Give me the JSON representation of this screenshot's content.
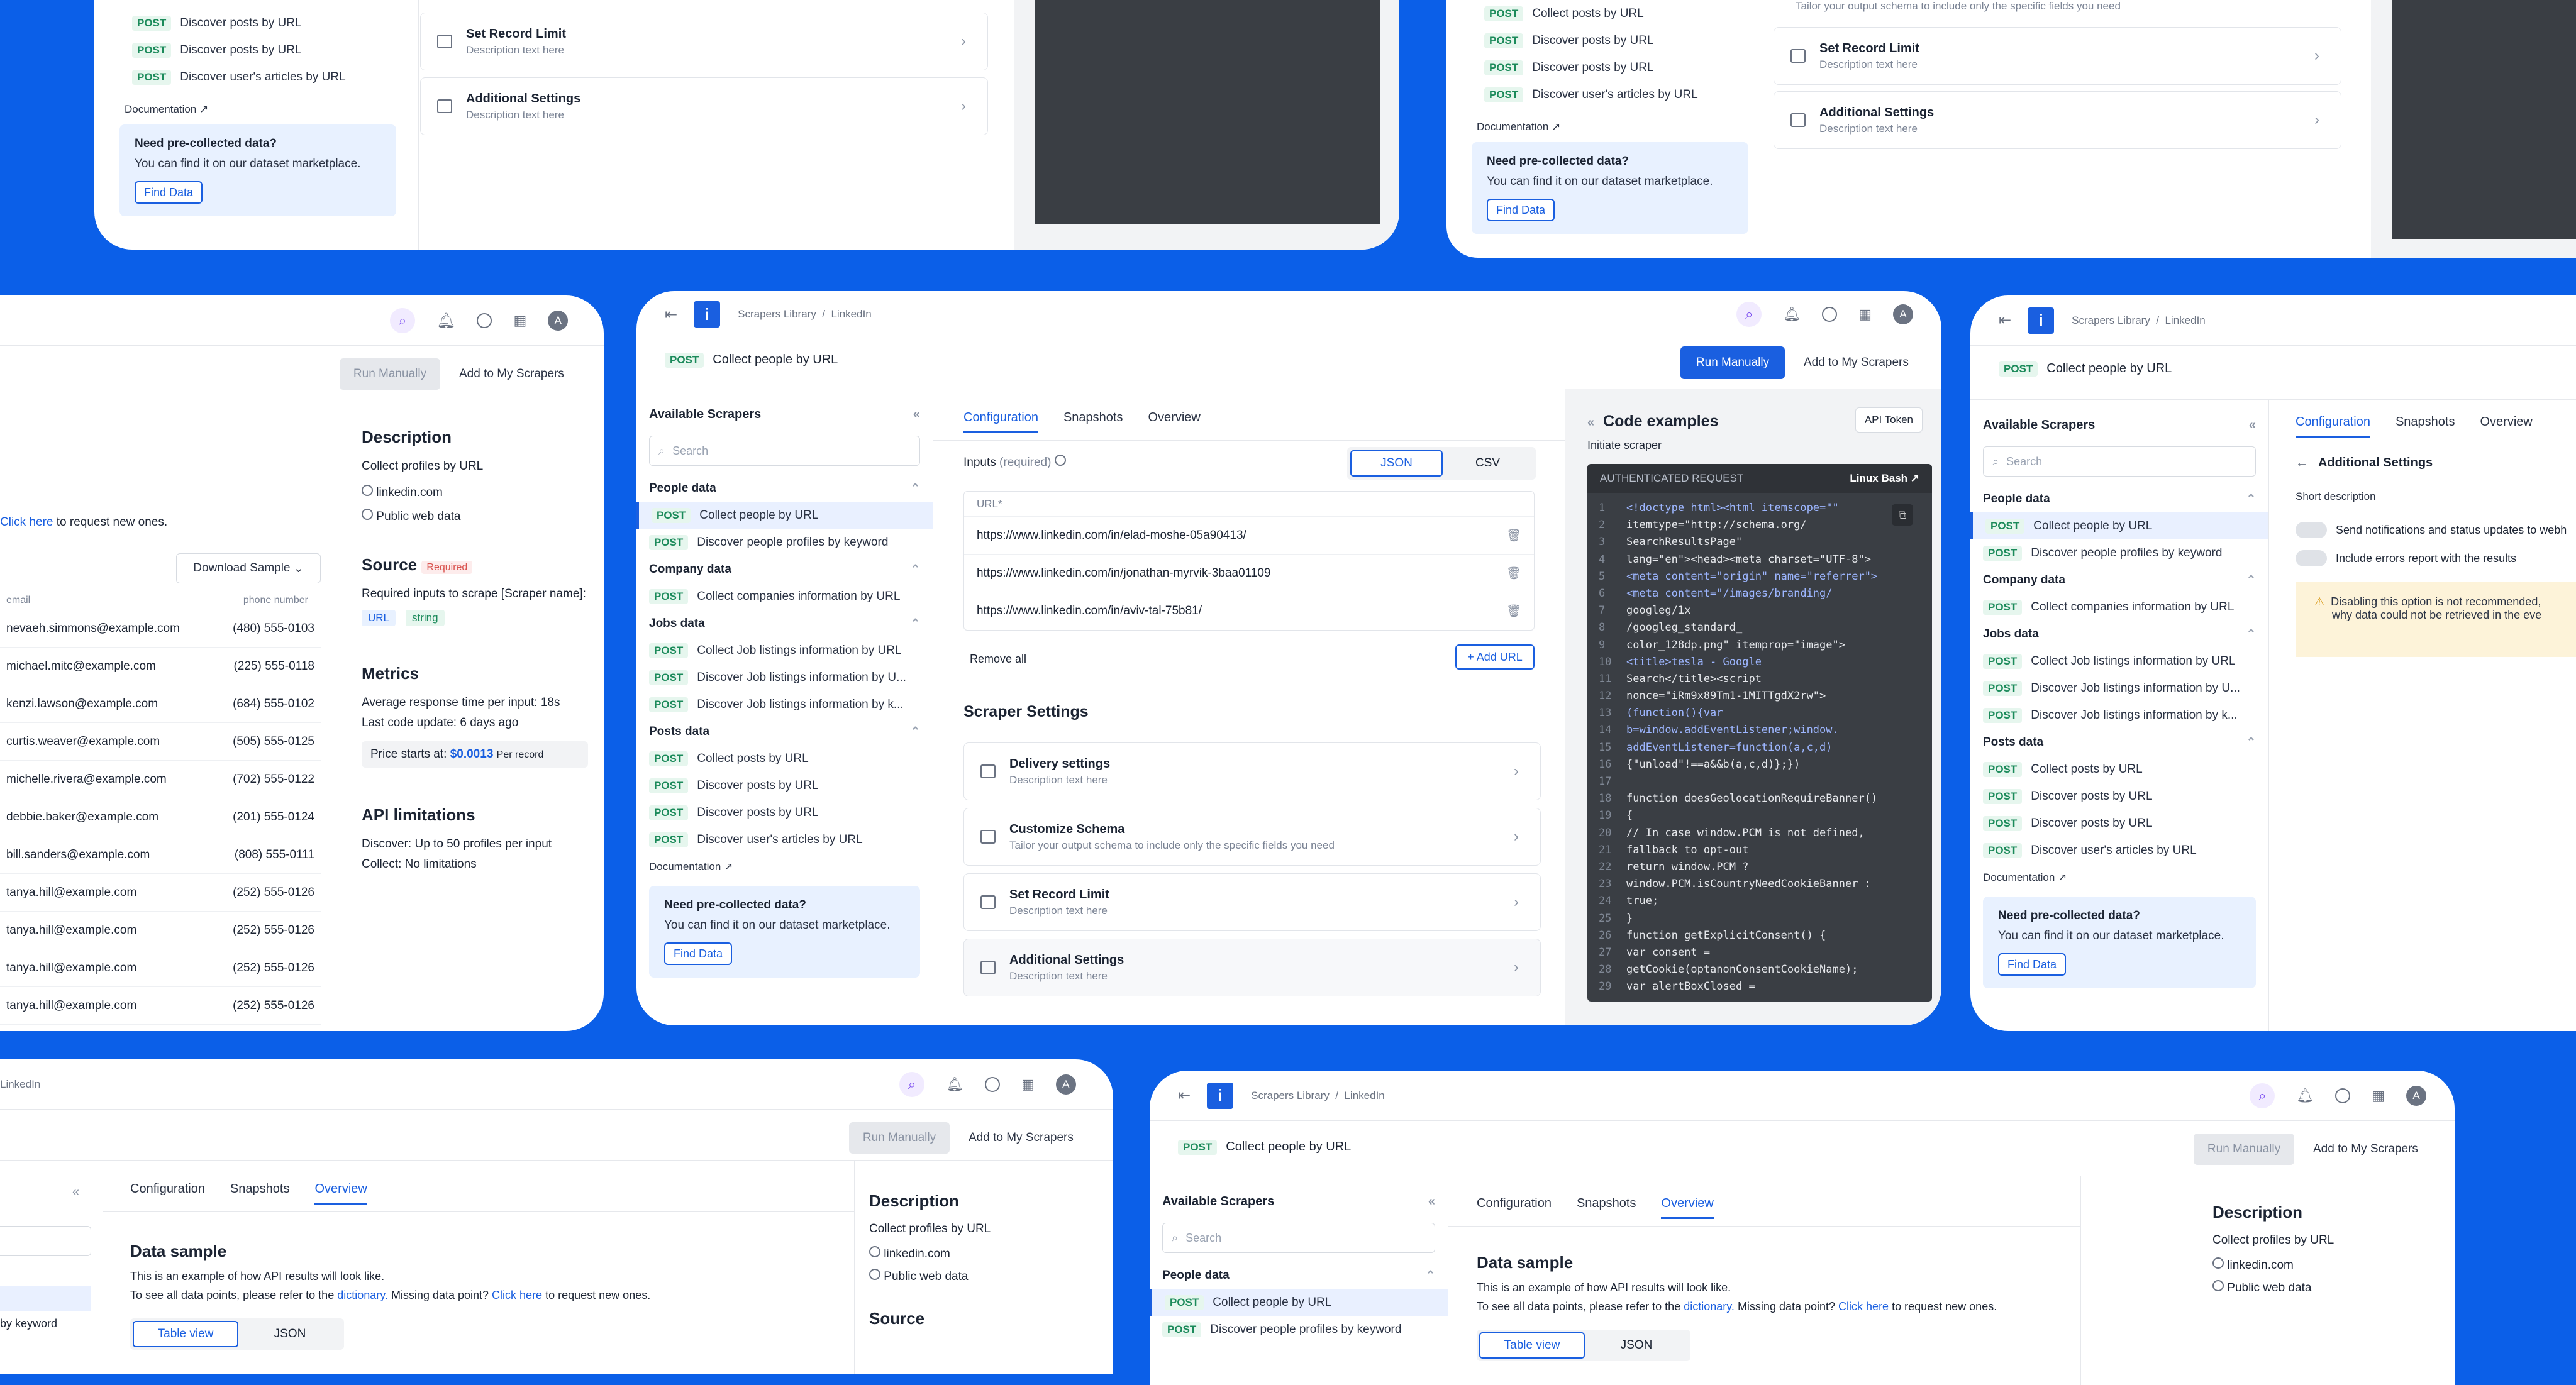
{
  "breadcrumb": {
    "root": "Scrapers Library",
    "sep": "/",
    "current": "LinkedIn"
  },
  "page": {
    "method": "POST",
    "title": "Collect people by URL"
  },
  "actions": {
    "run": "Run Manually",
    "add": "Add to My Scrapers"
  },
  "avatar": "A",
  "sidebar": {
    "title": "Available Scrapers",
    "search_placeholder": "Search",
    "groups": [
      {
        "name": "People data",
        "items": [
          "Collect people by URL",
          "Discover people profiles by keyword"
        ]
      },
      {
        "name": "Company data",
        "items": [
          "Collect companies information by URL"
        ]
      },
      {
        "name": "Jobs data",
        "items": [
          "Collect Job listings information by URL",
          "Discover Job listings information by U...",
          "Discover Job listings information by k..."
        ]
      },
      {
        "name": "Posts data",
        "items": [
          "Collect posts by URL",
          "Discover posts by URL",
          "Discover posts by URL",
          "Discover user's articles by URL"
        ]
      }
    ],
    "documentation": "Documentation",
    "promo": {
      "title": "Need pre-collected data?",
      "desc": "You can find it on our dataset marketplace.",
      "button": "Find Data"
    }
  },
  "tabs": [
    "Configuration",
    "Snapshots",
    "Overview"
  ],
  "inputs": {
    "label": "Inputs",
    "req": "(required)",
    "format_json": "JSON",
    "format_csv": "CSV",
    "col": "URL*",
    "urls": [
      "https://www.linkedin.com/in/elad-moshe-05a90413/",
      "https://www.linkedin.com/in/jonathan-myrvik-3baa01109",
      "https://www.linkedin.com/in/aviv-tal-75b81/"
    ],
    "remove_all": "Remove all",
    "add_url": "+ Add URL"
  },
  "scraper_settings": {
    "title": "Scraper Settings",
    "items": [
      {
        "title": "Delivery settings",
        "desc": "Description text here"
      },
      {
        "title": "Customize Schema",
        "desc": "Tailor your output schema to include only the specific fields you need"
      },
      {
        "title": "Set Record Limit",
        "desc": "Description text here"
      },
      {
        "title": "Additional Settings",
        "desc": "Description text here"
      }
    ]
  },
  "code": {
    "title": "Code examples",
    "token": "API Token",
    "sub": "Initiate scraper",
    "bar": "AUTHENTICATED REQUEST",
    "lang": "Linux Bash",
    "lines": [
      "<!doctype html><html itemscope=\"\"",
      "itemtype=\"http://schema.org/",
      "SearchResultsPage\"",
      "lang=\"en\"><head><meta charset=\"UTF-8\">",
      "<meta content=\"origin\" name=\"referrer\">",
      "<meta content=\"/images/branding/",
      "googleg/1x",
      "/googleg_standard_",
      "color_128dp.png\" itemprop=\"image\">",
      "<title>tesla - Google",
      "Search</title><script",
      "nonce=\"iRm9x89Tm1-1MITTgdX2rw\">",
      "(function(){var",
      "b=window.addEventListener;window.",
      "addEventListener=function(a,c,d)",
      "{\"unload\"!==a&&b(a,c,d)};})",
      "",
      "function doesGeolocationRequireBanner()",
      "{",
      "// In case window.PCM is not defined,",
      "fallback to opt-out",
      "return window.PCM ?",
      "window.PCM.isCountryNeedCookieBanner :",
      "true;",
      "}",
      "function getExplicitConsent() {",
      "var consent =",
      "getCookie(optanonConsentCookieName);",
      "var alertBoxClosed ="
    ]
  },
  "overview": {
    "description_title": "Description",
    "description": "Collect profiles by URL",
    "site": "linkedin.com",
    "public": "Public web data",
    "source_title": "Source",
    "required": "Required",
    "source_desc": "Required inputs to scrape [Scraper name]:",
    "tag_url": "URL",
    "tag_string": "string",
    "metrics_title": "Metrics",
    "avg": "Average response time per input:",
    "avg_v": "18s",
    "last": "Last code update:",
    "last_v": "6 days ago",
    "price": "Price starts at:",
    "price_v": "$0.0013",
    "price_u": "Per record",
    "api_title": "API limitations",
    "discover": "Discover:",
    "discover_v": "Up to 50 profiles per input",
    "collect": "Collect:",
    "collect_v": "No limitations",
    "sample_title": "Data sample",
    "sample_desc": "This is an example of how API results will look like.",
    "sample_more1": "To see all data points, please refer to the",
    "dictionary": "dictionary.",
    "missing": "Missing data point?",
    "click_here": "Click here",
    "to_request": "to request new ones.",
    "table_view": "Table view",
    "json": "JSON",
    "download": "Download Sample",
    "col_email": "email",
    "col_phone": "phone number",
    "rows": [
      [
        "nevaeh.simmons@example.com",
        "(480) 555-0103"
      ],
      [
        "michael.mitc@example.com",
        "(225) 555-0118"
      ],
      [
        "kenzi.lawson@example.com",
        "(684) 555-0102"
      ],
      [
        "curtis.weaver@example.com",
        "(505) 555-0125"
      ],
      [
        "michelle.rivera@example.com",
        "(702) 555-0122"
      ],
      [
        "debbie.baker@example.com",
        "(201) 555-0124"
      ],
      [
        "bill.sanders@example.com",
        "(808) 555-0111"
      ],
      [
        "tanya.hill@example.com",
        "(252) 555-0126"
      ],
      [
        "tanya.hill@example.com",
        "(252) 555-0126"
      ],
      [
        "tanya.hill@example.com",
        "(252) 555-0126"
      ],
      [
        "tanya.hill@example.com",
        "(252) 555-0126"
      ]
    ],
    "frag_keyword": "by keyword",
    "frag_source": "Source"
  },
  "additional": {
    "back_title": "Additional Settings",
    "short": "Short description",
    "toggle1": "Send notifications and status updates to webh",
    "toggle2": "Include errors report with the results",
    "warn1": "Disabling this option is not recommended,",
    "warn2": "why data could not be retrieved in the eve"
  },
  "top_fragments": {
    "tailor": "Tailor your output schema to include only the specific fields you need"
  }
}
